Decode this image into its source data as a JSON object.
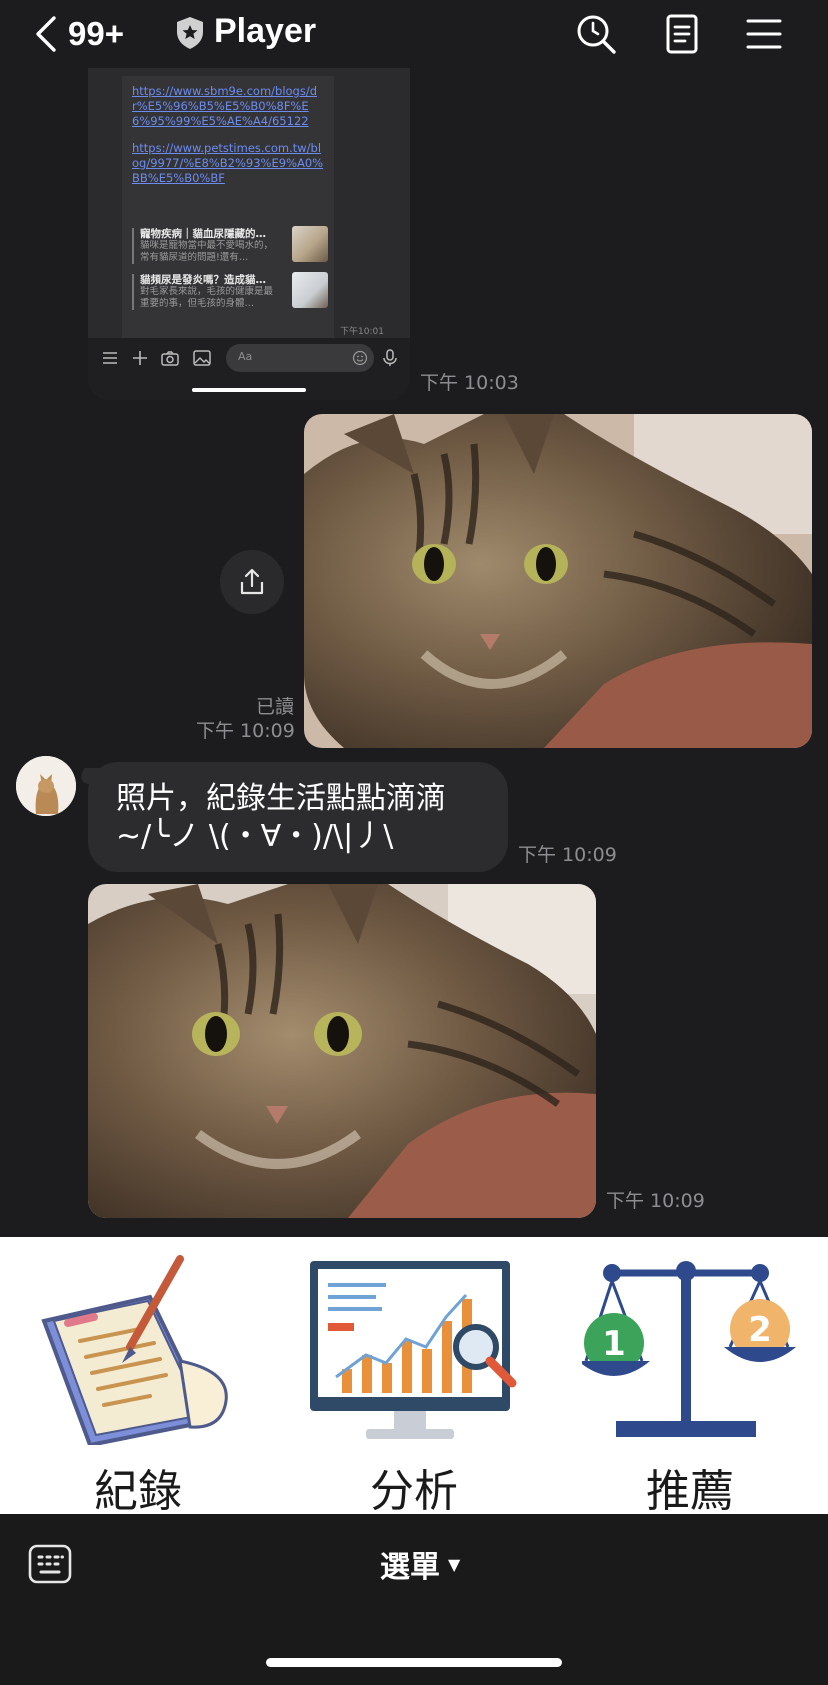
{
  "header": {
    "unread_count": "99+",
    "title": "Player",
    "icons": [
      "back-chevron-icon",
      "shield-icon",
      "search-icon",
      "notes-icon",
      "menu-icon"
    ]
  },
  "messages": {
    "screenshot": {
      "links": [
        "https://www.sbm9e.com/blogs/dr%E5%96%B5%E5%B0%8F%E6%95%99%E5%AE%A4/65122",
        "https://www.petstimes.com.tw/blog/9977/%E8%B2%93%E9%A0%BB%E5%B0%BF"
      ],
      "cards": [
        {
          "title": "寵物疾病｜貓血尿隱藏的…",
          "desc": "貓咪是寵物當中最不愛喝水的，常有貓尿道的問題!還有…"
        },
        {
          "title": "貓頻尿是發炎嗎？造成貓…",
          "desc": "對毛家長來說，毛孩的健康是最重要的事，但毛孩的身體…"
        }
      ],
      "inner_time": "下午10:01",
      "input_placeholder": "Aa",
      "time": "下午 10:03"
    },
    "sent_photo": {
      "read_label": "已讀",
      "time": "下午 10:09"
    },
    "received_text": {
      "line1": "照片，紀錄生活點點滴滴",
      "line2": "~/╰ノ \\(・∀・)/\\|丿\\",
      "time": "下午 10:09"
    },
    "received_photo": {
      "time": "下午 10:09"
    }
  },
  "rich_menu": {
    "items": [
      {
        "label": "紀錄",
        "icon": "notebook-pen-icon"
      },
      {
        "label": "分析",
        "icon": "analytics-chart-icon"
      },
      {
        "label": "推薦",
        "icon": "balance-scale-icon"
      }
    ]
  },
  "bottom_bar": {
    "menu_label": "選單",
    "arrow": "▼"
  },
  "colors": {
    "chat_bg": "#1c1c1e",
    "bubble_bg": "#2c2c2e",
    "link": "#6c8cf0",
    "timestamp": "#8e8e92"
  }
}
